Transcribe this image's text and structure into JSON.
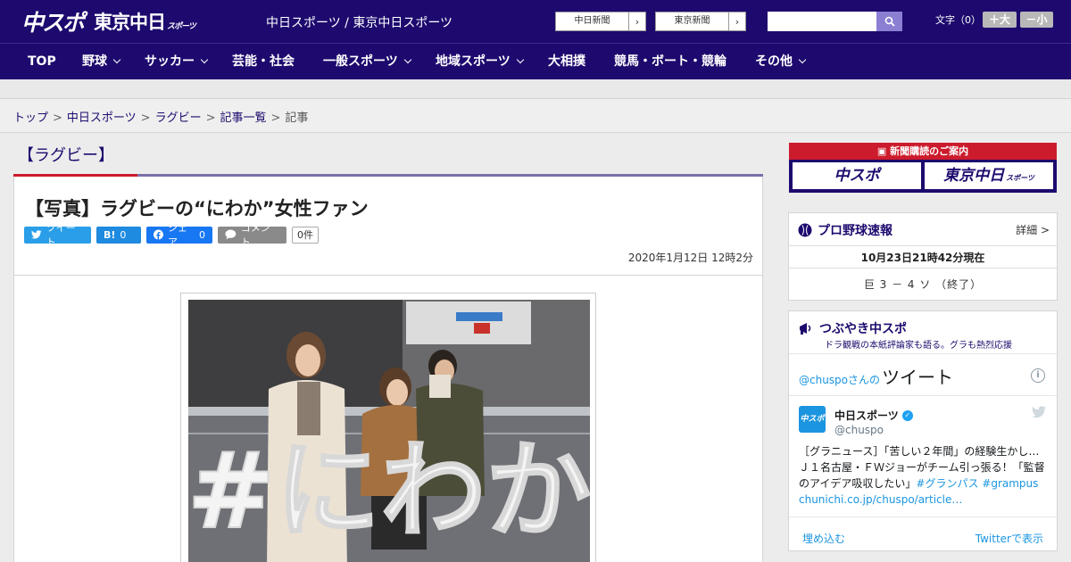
{
  "header": {
    "logo_main": "中スポ",
    "logo_sub": "東京中日",
    "logo_sub_small": "スポーツ",
    "site_name": "中日スポーツ / 東京中日スポーツ",
    "ext_links": [
      {
        "label": "中日新聞"
      },
      {
        "label": "東京新聞"
      }
    ],
    "search_placeholder": "",
    "fontsize_label": "文字（0）",
    "font_larger": "＋大",
    "font_smaller": "－小"
  },
  "nav": {
    "items": [
      {
        "label": "TOP"
      },
      {
        "label": "野球"
      },
      {
        "label": "サッカー"
      },
      {
        "label": "芸能・社会"
      },
      {
        "label": "一般スポーツ"
      },
      {
        "label": "地域スポーツ"
      },
      {
        "label": "大相撲"
      },
      {
        "label": "競馬・ボート・競輪"
      },
      {
        "label": "その他"
      }
    ]
  },
  "breadcrumb": {
    "items": [
      "トップ",
      "中日スポーツ",
      "ラグビー",
      "記事一覧"
    ],
    "current": "記事",
    "separator": ">"
  },
  "article": {
    "category": "【ラグビー】",
    "title": "【写真】ラグビーの“にわか”女性ファン",
    "share": {
      "tweet": "ツイート",
      "hatena": "B!",
      "hatena_count": "0",
      "facebook": "シェア",
      "facebook_count": "0",
      "comment": "コメント",
      "comment_count": "0件"
    },
    "date": "2020年1月12日 12時2分",
    "photo_text": "#にわか"
  },
  "sidebar": {
    "subscription": {
      "title": "新聞購読のご案内",
      "logo1": "中スポ",
      "logo2": "東京中日",
      "logo2_small": "スポーツ"
    },
    "baseball": {
      "title": "プロ野球速報",
      "more": "詳細 >",
      "asof": "10月23日21時42分現在",
      "score": "巨 3 － 4 ソ （終了）"
    },
    "tsubuyaki": {
      "title": "つぶやき中スポ",
      "subtitle": "ドラ観戦の本紙評論家も語る。グラも熱烈応援",
      "embed_handle": "@chuspo",
      "embed_san": "さんの",
      "embed_tweet": "ツイート",
      "user_name": "中日スポーツ",
      "user_handle": "@chuspo",
      "avatar_text": "中スポ",
      "text": "［グラニュース］「苦しい２年間」の経験生かし…Ｊ１名古屋・ＦＷジョーがチーム引っ張る！「監督のアイデア吸収したい」",
      "hashtags": "#グランパス #grampus",
      "link": "chunichi.co.jp/chuspo/article…",
      "embed_label": "埋め込む",
      "view_label": "Twitterで表示"
    }
  },
  "colors": {
    "brand_navy": "#1e0a6e",
    "accent_red": "#cc1b2c",
    "twitter_blue": "#1b95e0"
  }
}
